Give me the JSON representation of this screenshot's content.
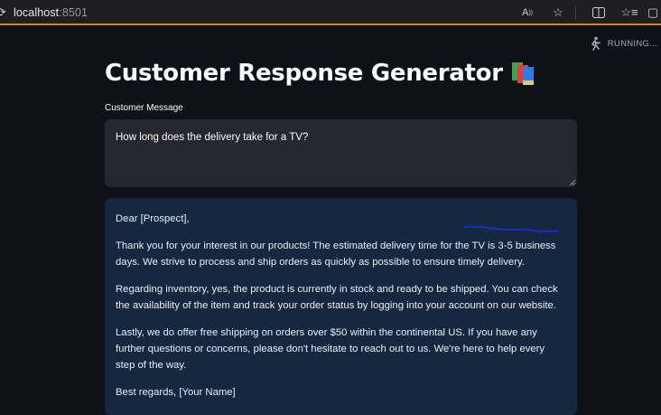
{
  "browser": {
    "url_host": "localhost",
    "url_port": ":8501",
    "icons": [
      "read-aloud-icon",
      "favorite-star-icon",
      "split-screen-icon",
      "favorites-icon",
      "collections-icon"
    ]
  },
  "app": {
    "status": "RUNNING...",
    "title": "Customer Response Generator",
    "title_icon": "books-icon",
    "input_label": "Customer Message",
    "input_value": "How long does the delivery take for a TV?",
    "response": {
      "greeting": "Dear [Prospect],",
      "p1": "Thank you for your interest in our products! The estimated delivery time for the TV is 3-5 business days. We strive to process and ship orders as quickly as possible to ensure timely delivery.",
      "p2": "Regarding inventory, yes, the product is currently in stock and ready to be shipped. You can check the availability of the item and track your order status by logging into your account on our website.",
      "p3": "Lastly, we do offer free shipping on orders over $50 within the continental US. If you have any further questions or concerns, please don't hesitate to reach out to us. We're here to help every step of the way.",
      "signoff": "Best regards, [Your Name]"
    }
  },
  "colors": {
    "background": "#0e1117",
    "input_bg": "#262730",
    "response_bg": "#15283f",
    "accent_line": "#c9872f",
    "annotation": "#1a2cc8"
  }
}
